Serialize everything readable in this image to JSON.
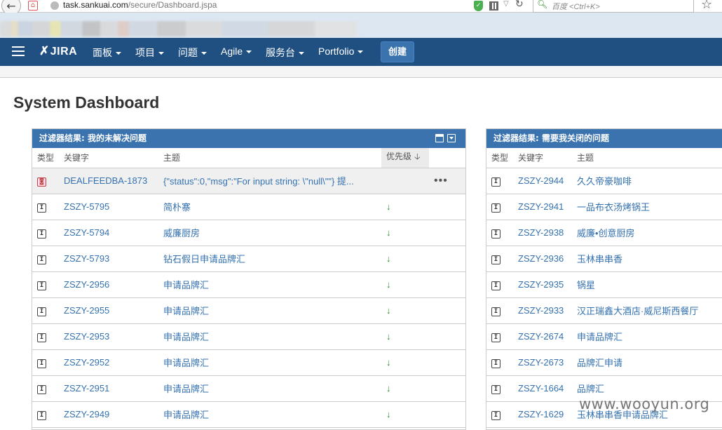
{
  "browser": {
    "url_host": "task.sankuai.com",
    "url_path": "/secure/Dashboard.jspa",
    "search_placeholder": "百度 <Ctrl+K>"
  },
  "nav": {
    "logo": "JIRA",
    "items": [
      "面板",
      "项目",
      "问题",
      "Agile",
      "服务台",
      "Portfolio"
    ],
    "create": "创建"
  },
  "page_title": "System Dashboard",
  "gadget_left": {
    "title": "过滤器结果: 我的未解决问题",
    "columns": {
      "type": "类型",
      "key": "关键字",
      "summary": "主题",
      "priority": "优先级"
    },
    "rows": [
      {
        "key": "DEALFEEDBA-1873",
        "summary": "{\"status\":0,\"msg\":\"For input string: \\\"null\\\"\"} 提...",
        "type": "bug",
        "priority": "",
        "more": "•••"
      },
      {
        "key": "ZSZY-5795",
        "summary": "简朴寨",
        "type": "task",
        "priority": "↓"
      },
      {
        "key": "ZSZY-5794",
        "summary": "威廉厨房",
        "type": "task",
        "priority": "↓"
      },
      {
        "key": "ZSZY-5793",
        "summary": "钻石假日申请品牌汇",
        "type": "task",
        "priority": "↓"
      },
      {
        "key": "ZSZY-2956",
        "summary": "申请品牌汇",
        "type": "task",
        "priority": "↓"
      },
      {
        "key": "ZSZY-2955",
        "summary": "申请品牌汇",
        "type": "task",
        "priority": "↓"
      },
      {
        "key": "ZSZY-2953",
        "summary": "申请品牌汇",
        "type": "task",
        "priority": "↓"
      },
      {
        "key": "ZSZY-2952",
        "summary": "申请品牌汇",
        "type": "task",
        "priority": "↓"
      },
      {
        "key": "ZSZY-2951",
        "summary": "申请品牌汇",
        "type": "task",
        "priority": "↓"
      },
      {
        "key": "ZSZY-2949",
        "summary": "申请品牌汇",
        "type": "task",
        "priority": "↓"
      }
    ]
  },
  "gadget_right": {
    "title": "过滤器结果: 需要我关闭的问题",
    "columns": {
      "type": "类型",
      "key": "关键字",
      "summary": "主题"
    },
    "rows": [
      {
        "key": "ZSZY-2944",
        "summary": "久久帝豪咖啡"
      },
      {
        "key": "ZSZY-2941",
        "summary": "一品布衣汤烤锅王"
      },
      {
        "key": "ZSZY-2938",
        "summary": "威廉•创意厨房"
      },
      {
        "key": "ZSZY-2936",
        "summary": "玉林串串香"
      },
      {
        "key": "ZSZY-2935",
        "summary": "锅星"
      },
      {
        "key": "ZSZY-2933",
        "summary": "汉正瑞鑫大酒店·威尼斯西餐厅"
      },
      {
        "key": "ZSZY-2674",
        "summary": "申请品牌汇"
      },
      {
        "key": "ZSZY-2673",
        "summary": "品牌汇申请"
      },
      {
        "key": "ZSZY-1664",
        "summary": "品牌汇"
      },
      {
        "key": "ZSZY-1629",
        "summary": "玉林串串香申请品牌汇"
      }
    ]
  },
  "watermark": "www.wooyun.org",
  "colors": {
    "header_bg": "#205081",
    "gadget_head": "#3b73af",
    "link": "#3572b0",
    "priority_low": "#2e8b2e"
  }
}
